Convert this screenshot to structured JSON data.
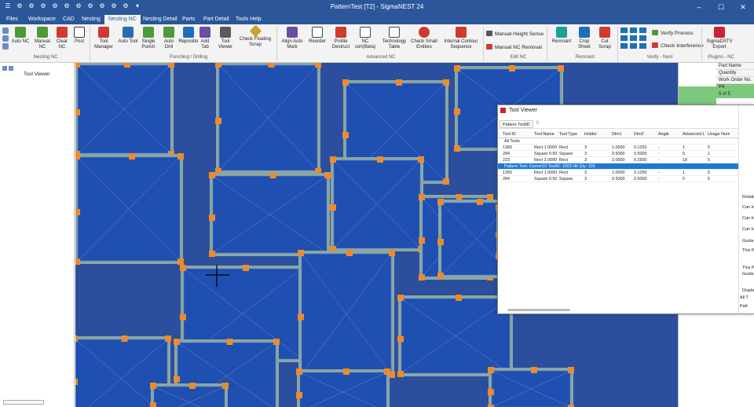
{
  "window": {
    "title": "PatternTest [T2] - SigmaNEST 24",
    "controls": [
      "–",
      "☐",
      "✕"
    ]
  },
  "qat": [
    "☰",
    "⚙",
    "⚙",
    "⚙",
    "⚙",
    "⚙",
    "⚙",
    "⚙",
    "⚙",
    "⚙",
    "⚙",
    "▾"
  ],
  "tabs": [
    "Files",
    "Workspace",
    "CAD",
    "Nesting",
    "Nesting NC",
    "Nesting Detail",
    "Parts",
    "Part Detail",
    "Tools Help"
  ],
  "active_tab": "Nesting NC",
  "ribbon": {
    "nc_auto": "Auto NC",
    "nc_manual": "Manual NC",
    "nc_clear": "Clear NC",
    "nc_post": "Post",
    "nc_group": "Nesting NC",
    "b_tool_manager": "Tool Manager",
    "b_auto_tool": "Auto Tool",
    "b_single_punch": "Single Punch",
    "b_auto_drill": "Auto Drill",
    "b_reposition": "Repositio",
    "b_add_tab": "Add Tab",
    "b_tool_viewer": "Tool Viewer",
    "b_check_floating": "Check Floating Scrap",
    "punch_group": "Punching / Drilling",
    "b_align": "Align Auto Mark",
    "b_reorder": "Reorder",
    "b_profile": "Profile Destruct",
    "b_nc_sort": "NC sort(Beta)",
    "b_tech_table": "Technology Table",
    "b_check_small": "Check Small Entities",
    "b_internal": "Internal Contour Sequence",
    "adv_group": "Advanced NC",
    "b_manual_height": "Manual Height Sense",
    "b_manual_removal": "Manual NC Removal",
    "edit_group": "Edit NC",
    "b_remnant": "Remnant",
    "b_crop": "Crop Sheet",
    "b_cut_scrap": "Cut Scrap",
    "remnant_group": "Remnant",
    "b_verify_process": "Verify Process",
    "b_check_interference": "Check Interference",
    "verify_group": "Verify - Nest",
    "b_sigmadstv": "SigmaDSTV Export",
    "plugins_group": "Plugins - NC"
  },
  "sidebar": {
    "header": "Tool Viewer"
  },
  "right_panel": {
    "part_name": "Part Name",
    "quantity": "Quantity",
    "work_order": "Work Order No.",
    "part_value": "P4",
    "qty_value": "5 of 5"
  },
  "tool_viewer": {
    "title": "Tool Viewer",
    "filter_button": "Pattern ToolID",
    "columns": [
      "Tool ID",
      "Tool Name",
      "Tool Type",
      "Holder",
      "Dim1",
      "Dim2",
      "Angle",
      "Advanced L",
      "Usage Num"
    ],
    "group_all": "All Tools",
    "rows_all": [
      [
        "1365",
        "Rect 1.0000",
        "Rect",
        "3",
        "1.0000",
        "0.1250",
        "-",
        "1",
        "5"
      ],
      [
        "284",
        "Square 0.50",
        "Square",
        "3",
        "0.5000",
        "0.5000",
        "-",
        "5",
        "1"
      ],
      [
        "223",
        "Rect 2.0000",
        "Rect",
        "3",
        "2.0000",
        "0.2500",
        "-",
        "18",
        "5"
      ]
    ],
    "group_pattern": "Pattern Tool: Corner10 ToolID: 1503 Hit Qty: 100",
    "rows_pattern": [
      [
        "1365",
        "Rect 1.0000",
        "Rect",
        "3",
        "1.0000",
        "0.1250",
        "-",
        "1",
        "5"
      ],
      [
        "284",
        "Square 0.50",
        "Square",
        "3",
        "0.5000",
        "0.5000",
        "-",
        "5",
        "5"
      ]
    ],
    "side_labels": [
      "Rotatio",
      "Can b",
      "Can b",
      "Can b",
      "Guide",
      "This P",
      "This P",
      "Guide",
      "Displa",
      "All T",
      "Patt"
    ]
  },
  "colors": {
    "titlebar": "#2b579a",
    "sheet": "#2b4f9e",
    "part": "#1f4fb0",
    "selection": "#1e78d6",
    "tab_orange": "#f08a28"
  }
}
